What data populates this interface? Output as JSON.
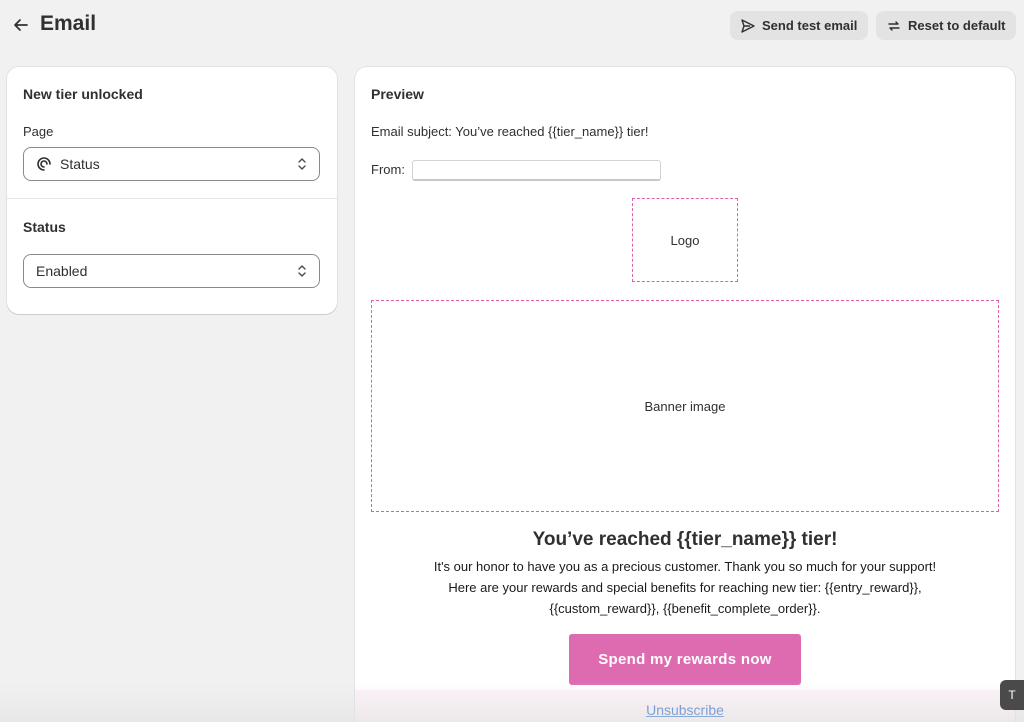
{
  "header": {
    "title": "Email",
    "send_test_label": "Send test email",
    "reset_label": "Reset to default"
  },
  "settings": {
    "section_title": "New tier unlocked",
    "page_label": "Page",
    "page_value": "Status",
    "status_title": "Status",
    "status_value": "Enabled"
  },
  "preview": {
    "title": "Preview",
    "subject": "Email subject: You’ve reached {{tier_name}} tier!",
    "from_label": "From:",
    "from_value": "",
    "logo_label": "Logo",
    "banner_label": "Banner image",
    "heading": "You’ve reached {{tier_name}} tier!",
    "body_lines": [
      "It's our honor to have you as a precious customer. Thank you so much for your support!",
      "Here are your rewards and special benefits for reaching new tier: {{entry_reward}},",
      "{{custom_reward}}, {{benefit_complete_order}}."
    ],
    "cta_label": "Spend my rewards now",
    "unsubscribe_label": "Unsubscribe"
  },
  "corner_tab_label": "T",
  "colors": {
    "accent_pink": "#de6bb0",
    "dashed_border": "#e05fa8",
    "link_blue": "#2c6ecb",
    "background": "#f1f1f1"
  }
}
